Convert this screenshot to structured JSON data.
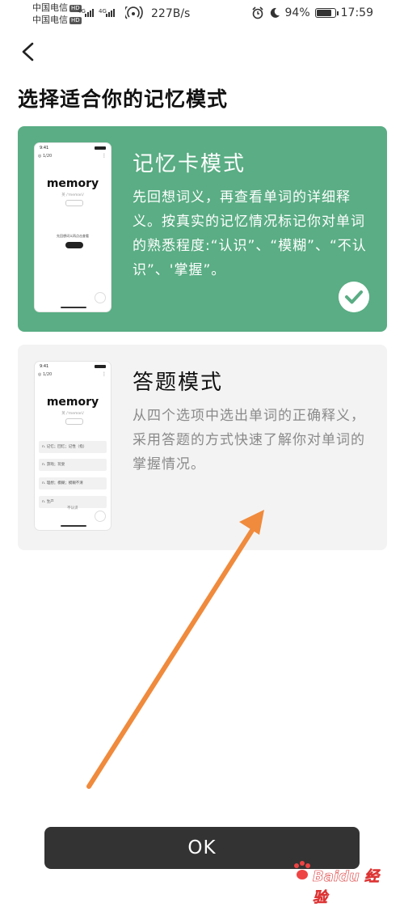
{
  "status_bar": {
    "carrier_1": "中国电信",
    "carrier_2": "中国电信",
    "hd_badge": "HD",
    "net_type": "4G",
    "net_speed": "227B/s",
    "battery_text": "94%",
    "battery_level": 0.94,
    "time": "17:59",
    "icons": [
      "alarm-icon",
      "moon-icon",
      "battery-icon",
      "wifi-icon",
      "signal-icon"
    ]
  },
  "header": {
    "title": "选择适合你的记忆模式"
  },
  "modes": [
    {
      "title": "记忆卡模式",
      "description": "先回想词义，再查看单词的详细释义。按真实的记忆情况标记你对单词的熟悉程度:“认识”、“模糊”、“不认识”、'掌握”。",
      "selected": true,
      "preview": {
        "time": "9:41",
        "word": "memory",
        "phonetic": "英 /ˈmeməri/",
        "hint": "先回想词义再点击查看",
        "button": "查看释义"
      }
    },
    {
      "title": "答题模式",
      "description": "从四个选项中选出单词的正确释义，采用答题的方式快速了解你对单词的掌握情况。",
      "selected": false,
      "preview": {
        "time": "9:41",
        "word": "memory",
        "phonetic": "英 /ˈmeməri/",
        "options": [
          "n. 记忆；回忆；记性（指）",
          "n. 游戏；玩耍",
          "n. 理想；模糊；模糊不清",
          "n. 生产"
        ],
        "footer": "不认识"
      }
    }
  ],
  "ok_button": "OK",
  "watermark": "Baidu 经验",
  "colors": {
    "accent_green": "#5aad84",
    "card_gray": "#f3f3f3",
    "button_dark": "#333333",
    "annotation_arrow": "#f08a3c"
  }
}
